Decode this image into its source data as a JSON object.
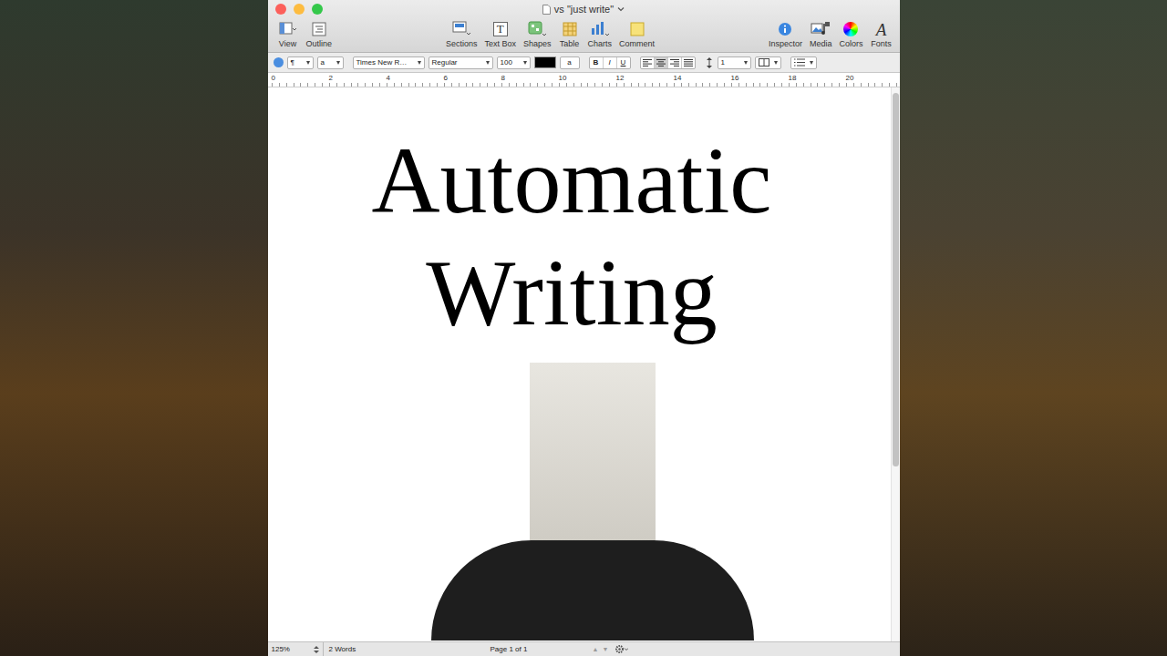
{
  "window": {
    "title": "vs \"just write\""
  },
  "toolbar": {
    "left": [
      {
        "label": "View",
        "kind": "view"
      },
      {
        "label": "Outline",
        "kind": "outline"
      }
    ],
    "center": [
      {
        "label": "Sections",
        "kind": "sections"
      },
      {
        "label": "Text Box",
        "kind": "textbox",
        "glyph": "T"
      },
      {
        "label": "Shapes",
        "kind": "shapes"
      },
      {
        "label": "Table",
        "kind": "table"
      },
      {
        "label": "Charts",
        "kind": "charts"
      },
      {
        "label": "Comment",
        "kind": "comment"
      }
    ],
    "right": [
      {
        "label": "Inspector",
        "kind": "inspector"
      },
      {
        "label": "Media",
        "kind": "media"
      },
      {
        "label": "Colors",
        "kind": "colors"
      },
      {
        "label": "Fonts",
        "kind": "fonts",
        "glyph": "A"
      }
    ]
  },
  "format_bar": {
    "paragraph_style": "¶",
    "character_style": "a",
    "font": "Times New R…",
    "typeface": "Regular",
    "size": "100",
    "text_color": "#000000",
    "highlight": "a",
    "styles": [
      "B",
      "I",
      "U"
    ],
    "alignments": [
      {
        "kind": "left",
        "selected": false
      },
      {
        "kind": "center",
        "selected": true
      },
      {
        "kind": "right",
        "selected": false
      },
      {
        "kind": "justify",
        "selected": false
      }
    ],
    "line_spacing": "1"
  },
  "ruler": {
    "ticks": [
      "0",
      "2",
      "4",
      "6",
      "8",
      "10",
      "12",
      "14",
      "16",
      "18",
      "20"
    ]
  },
  "document": {
    "lines": [
      "Automatic",
      "Writing"
    ]
  },
  "status_bar": {
    "zoom": "125%",
    "words": "2 Words",
    "page": "Page 1 of 1",
    "nav": [
      "▲",
      "▼"
    ]
  }
}
